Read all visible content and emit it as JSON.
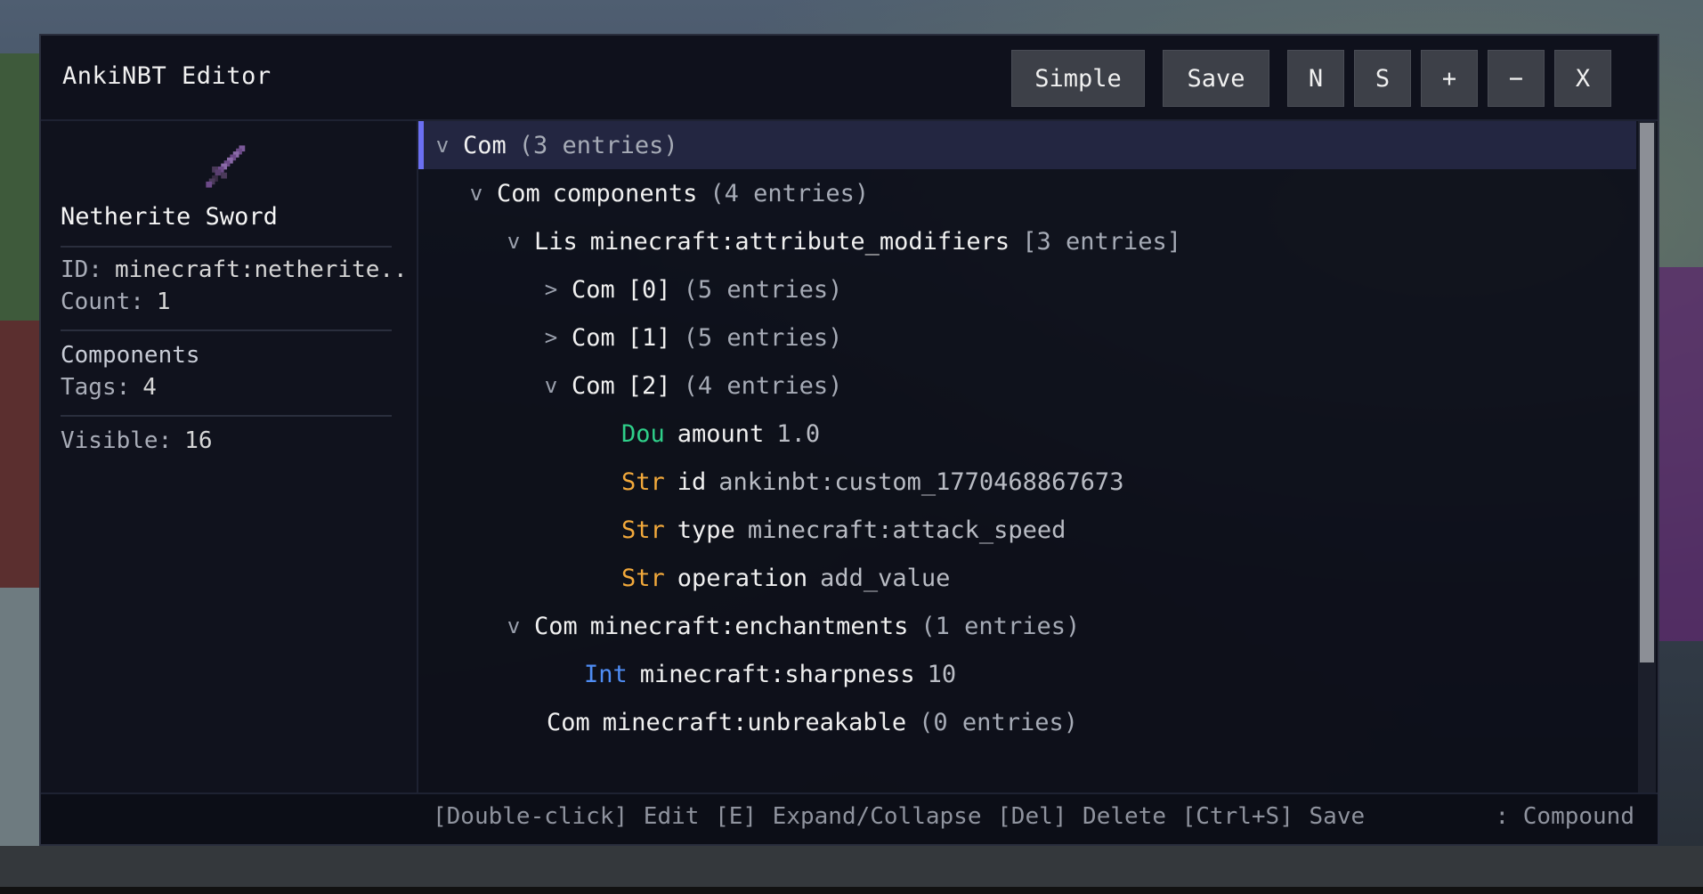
{
  "window": {
    "title": "AnkiNBT Editor"
  },
  "toolbar": {
    "simple_label": "Simple",
    "save_label": "Save",
    "n_label": "N",
    "s_label": "S",
    "plus_label": "+",
    "minus_label": "−",
    "close_label": "X"
  },
  "item": {
    "name": "Netherite Sword",
    "id_label": "ID:",
    "id_value": "minecraft:netherite..",
    "count_label": "Count:",
    "count_value": "1",
    "components_label": "Components",
    "tags_label": "Tags:",
    "tags_value": "4",
    "visible_label": "Visible:",
    "visible_value": "16",
    "icon": "netherite-sword-icon"
  },
  "tree": {
    "rows": [
      {
        "caret": "v",
        "type": "Com",
        "key": "",
        "meta": "(3 entries)",
        "value": ""
      },
      {
        "caret": "v",
        "type": "Com",
        "key": "components",
        "meta": "(4 entries)",
        "value": ""
      },
      {
        "caret": "v",
        "type": "Lis",
        "key": "minecraft:attribute_modifiers",
        "meta": "[3 entries]",
        "value": ""
      },
      {
        "caret": ">",
        "type": "Com",
        "key": "[0]",
        "meta": "(5 entries)",
        "value": ""
      },
      {
        "caret": ">",
        "type": "Com",
        "key": "[1]",
        "meta": "(5 entries)",
        "value": ""
      },
      {
        "caret": "v",
        "type": "Com",
        "key": "[2]",
        "meta": "(4 entries)",
        "value": ""
      },
      {
        "caret": "",
        "type": "Dou",
        "key": "amount",
        "meta": "",
        "value": "1.0"
      },
      {
        "caret": "",
        "type": "Str",
        "key": "id",
        "meta": "",
        "value": "ankinbt:custom_1770468867673"
      },
      {
        "caret": "",
        "type": "Str",
        "key": "type",
        "meta": "",
        "value": "minecraft:attack_speed"
      },
      {
        "caret": "",
        "type": "Str",
        "key": "operation",
        "meta": "",
        "value": "add_value"
      },
      {
        "caret": "v",
        "type": "Com",
        "key": "minecraft:enchantments",
        "meta": "(1 entries)",
        "value": ""
      },
      {
        "caret": "",
        "type": "Int",
        "key": "minecraft:sharpness",
        "meta": "",
        "value": "10"
      },
      {
        "caret": "",
        "type": "Com",
        "key": "minecraft:unbreakable",
        "meta": "(0 entries)",
        "value": ""
      }
    ]
  },
  "footer": {
    "hints": "[Double-click] Edit  [E] Expand/Collapse  [Del] Delete  [Ctrl+S] Save",
    "status": ": Compound"
  },
  "colors": {
    "accent": "#6b6ff2",
    "double": "#2fd08a",
    "string": "#f2a93b",
    "int": "#4f8df5"
  }
}
